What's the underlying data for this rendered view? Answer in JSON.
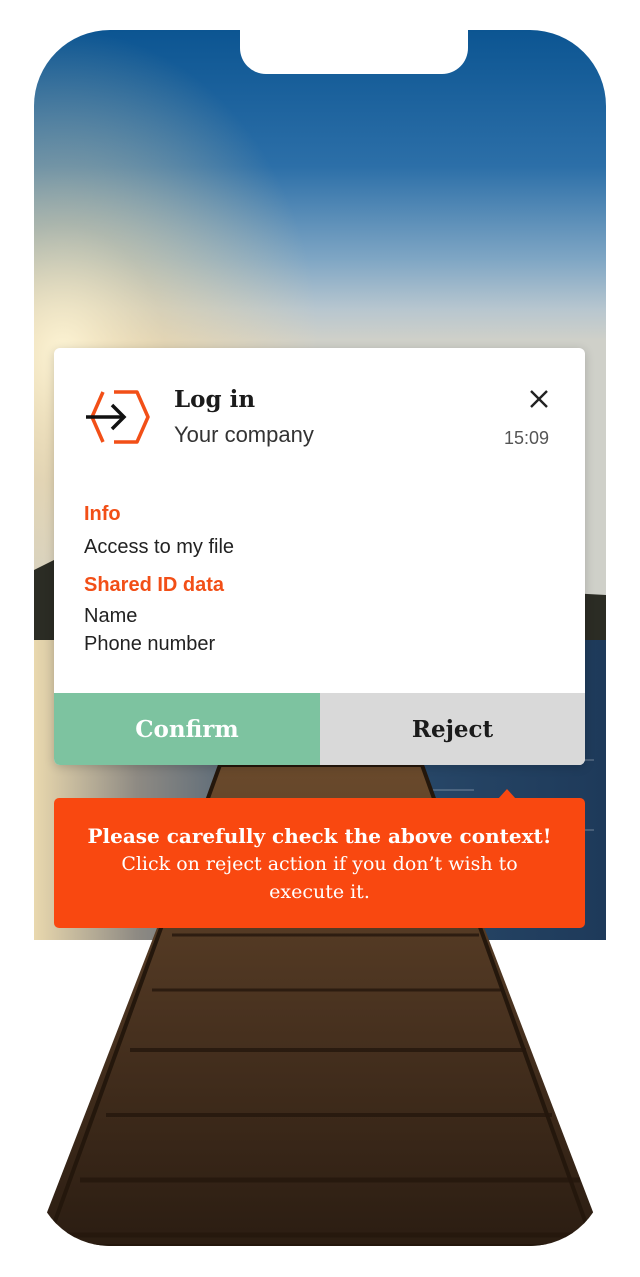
{
  "notification": {
    "app_icon": "login-arrow-hexagon-icon",
    "title": "Log in",
    "subtitle": "Your company",
    "time": "15:09",
    "close_icon": "close-icon",
    "info_label": "Info",
    "info_text": "Access to my file",
    "shared_label": "Shared ID data",
    "shared_items": [
      "Name",
      "Phone number"
    ]
  },
  "actions": {
    "confirm_label": "Confirm",
    "reject_label": "Reject"
  },
  "warning": {
    "title": "Please carefully check the above context!",
    "text": "Click on reject action if you don’t wish to execute it."
  },
  "colors": {
    "accent": "#f24f17",
    "warning_bg": "#f94810",
    "confirm_bg": "#7dc3a0",
    "reject_bg": "#d9d9d9"
  }
}
